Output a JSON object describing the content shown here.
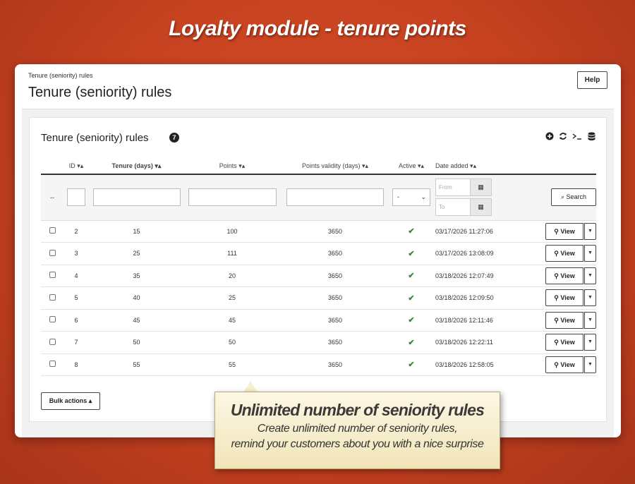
{
  "banner": "Loyalty module - tenure points",
  "breadcrumb": "Tenure (seniority) rules",
  "page_title": "Tenure (seniority) rules",
  "help_label": "Help",
  "card": {
    "title": "Tenure (seniority) rules",
    "count": "7",
    "tools": [
      "add-icon",
      "refresh-icon",
      "terminal-icon",
      "database-icon"
    ]
  },
  "columns": {
    "id": "ID",
    "tenure": "Tenure (days)",
    "points": "Points",
    "validity": "Points validity (days)",
    "active": "Active",
    "date": "Date added"
  },
  "filters": {
    "bulk_placeholder": "--",
    "active_select": "-",
    "from_placeholder": "From",
    "to_placeholder": "To",
    "search_label": "Search"
  },
  "rows": [
    {
      "id": "2",
      "tenure": "15",
      "points": "100",
      "validity": "3650",
      "active": true,
      "date": "03/17/2026 11:27:06"
    },
    {
      "id": "3",
      "tenure": "25",
      "points": "111",
      "validity": "3650",
      "active": true,
      "date": "03/17/2026 13:08:09"
    },
    {
      "id": "4",
      "tenure": "35",
      "points": "20",
      "validity": "3650",
      "active": true,
      "date": "03/18/2026 12:07:49"
    },
    {
      "id": "5",
      "tenure": "40",
      "points": "25",
      "validity": "3650",
      "active": true,
      "date": "03/18/2026 12:09:50"
    },
    {
      "id": "6",
      "tenure": "45",
      "points": "45",
      "validity": "3650",
      "active": true,
      "date": "03/18/2026 12:11:46"
    },
    {
      "id": "7",
      "tenure": "50",
      "points": "50",
      "validity": "3650",
      "active": true,
      "date": "03/18/2026 12:22:11"
    },
    {
      "id": "8",
      "tenure": "55",
      "points": "55",
      "validity": "3650",
      "active": true,
      "date": "03/18/2026 12:58:05"
    }
  ],
  "view_label": "View",
  "bulk_label": "Bulk actions",
  "callout": {
    "heading": "Unlimited number of seniority rules",
    "line1": "Create unlimited number of seniority rules,",
    "line2": "remind your customers about you with a nice surprise"
  },
  "colors": {
    "background": "#c5411f",
    "active_check": "#2e8b3d",
    "callout_bg": "#f5ecc8"
  }
}
